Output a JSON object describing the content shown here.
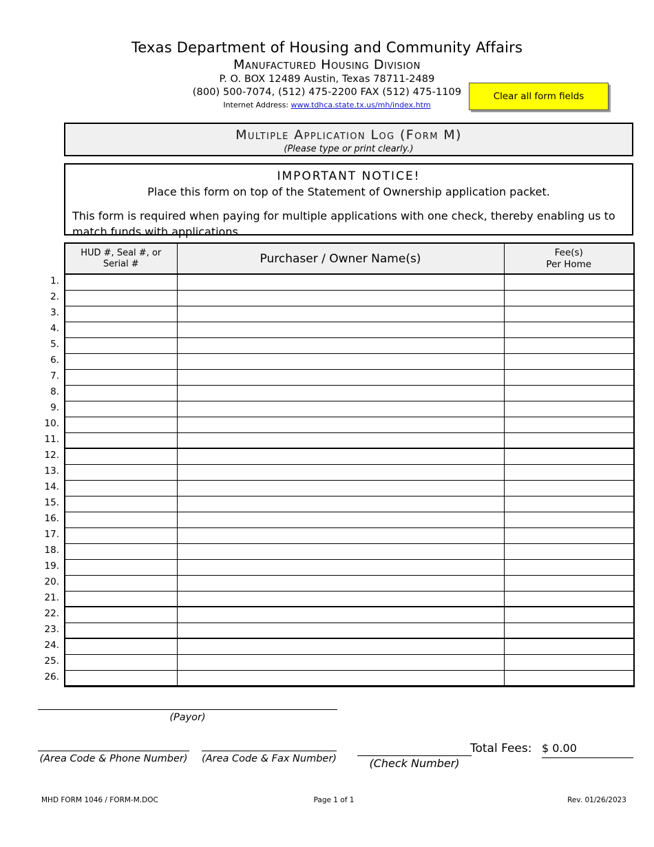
{
  "header": {
    "org_name": "Texas Department of Housing and Community Affairs",
    "division": "Manufactured Housing Division",
    "address": "P. O. BOX 12489   Austin,  Texas  78711-2489",
    "phones": "(800) 500-7074, (512) 475-2200  FAX  (512) 475-1109",
    "internet_label": "Internet Address:",
    "internet_url": "www.tdhca.state.tx.us/mh/index.htm",
    "link_color": "#1515cf"
  },
  "clear_button": {
    "label": "Clear all form fields",
    "background_color": "#ffff00",
    "border_color": "#4d4d4d"
  },
  "title_band": {
    "title": "Multiple Application Log (Form M)",
    "subtitle": "(Please type or print clearly.)",
    "background_color": "#f0f0f0"
  },
  "notice": {
    "heading": "IMPORTANT NOTICE!",
    "subheading": "Place this form on top of the Statement of Ownership application packet.",
    "body": "This form is required when paying for multiple applications with one check, thereby enabling us to match funds with applications."
  },
  "table": {
    "columns": [
      "HUD #, Seal #, or Serial #",
      "Purchaser / Owner Name(s)",
      "Fee(s) Per Home"
    ],
    "column_1_line_1": "HUD #, Seal #, or",
    "column_1_line_2": "Serial #",
    "column_2": "Purchaser / Owner Name(s)",
    "column_3_line_1": "Fee(s)",
    "column_3_line_2": "Per Home",
    "header_background": "#f0f0f0",
    "row_count": 26,
    "rows": [
      {
        "num": "1.",
        "hud": "",
        "name": "",
        "fee": ""
      },
      {
        "num": "2.",
        "hud": "",
        "name": "",
        "fee": ""
      },
      {
        "num": "3.",
        "hud": "",
        "name": "",
        "fee": ""
      },
      {
        "num": "4.",
        "hud": "",
        "name": "",
        "fee": ""
      },
      {
        "num": "5.",
        "hud": "",
        "name": "",
        "fee": ""
      },
      {
        "num": "6.",
        "hud": "",
        "name": "",
        "fee": ""
      },
      {
        "num": "7.",
        "hud": "",
        "name": "",
        "fee": ""
      },
      {
        "num": "8.",
        "hud": "",
        "name": "",
        "fee": ""
      },
      {
        "num": "9.",
        "hud": "",
        "name": "",
        "fee": ""
      },
      {
        "num": "10.",
        "hud": "",
        "name": "",
        "fee": ""
      },
      {
        "num": "11.",
        "hud": "",
        "name": "",
        "fee": ""
      },
      {
        "num": "12.",
        "hud": "",
        "name": "",
        "fee": ""
      },
      {
        "num": "13.",
        "hud": "",
        "name": "",
        "fee": ""
      },
      {
        "num": "14.",
        "hud": "",
        "name": "",
        "fee": ""
      },
      {
        "num": "15.",
        "hud": "",
        "name": "",
        "fee": ""
      },
      {
        "num": "16.",
        "hud": "",
        "name": "",
        "fee": ""
      },
      {
        "num": "17.",
        "hud": "",
        "name": "",
        "fee": ""
      },
      {
        "num": "18.",
        "hud": "",
        "name": "",
        "fee": ""
      },
      {
        "num": "19.",
        "hud": "",
        "name": "",
        "fee": ""
      },
      {
        "num": "20.",
        "hud": "",
        "name": "",
        "fee": ""
      },
      {
        "num": "21.",
        "hud": "",
        "name": "",
        "fee": ""
      },
      {
        "num": "22.",
        "hud": "",
        "name": "",
        "fee": ""
      },
      {
        "num": "23.",
        "hud": "",
        "name": "",
        "fee": ""
      },
      {
        "num": "24.",
        "hud": "",
        "name": "",
        "fee": ""
      },
      {
        "num": "25.",
        "hud": "",
        "name": "",
        "fee": ""
      },
      {
        "num": "26.",
        "hud": "",
        "name": "",
        "fee": ""
      }
    ]
  },
  "signature": {
    "payor_caption": "(Payor)",
    "phone_caption": "(Area Code & Phone Number)",
    "fax_caption": "(Area Code & Fax Number)",
    "check_caption": "(Check Number)",
    "payor_value": "",
    "phone_value": "",
    "fax_value": "",
    "check_value": "",
    "total_fees_label": "Total Fees:",
    "total_fees_value": "$ 0.00"
  },
  "footer": {
    "form_id": "MHD FORM 1046 / FORM-M.DOC",
    "page": "Page 1 of 1",
    "revision": "Rev. 01/26/2023"
  }
}
